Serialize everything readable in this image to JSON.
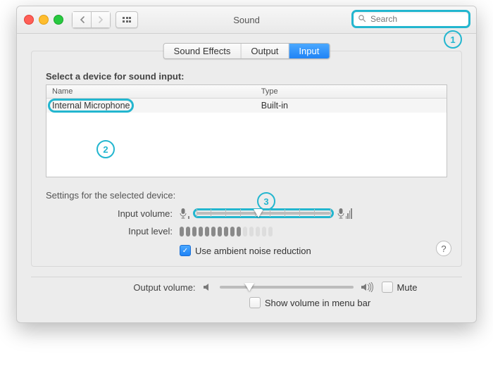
{
  "window": {
    "title": "Sound",
    "search_placeholder": "Search"
  },
  "tabs": [
    {
      "label": "Sound Effects",
      "active": false
    },
    {
      "label": "Output",
      "active": false
    },
    {
      "label": "Input",
      "active": true
    }
  ],
  "panel": {
    "select_device_label": "Select a device for sound input:",
    "columns": [
      "Name",
      "Type"
    ],
    "devices": [
      {
        "name": "Internal Microphone",
        "type": "Built-in"
      }
    ],
    "settings_label": "Settings for the selected device:",
    "input_volume_label": "Input volume:",
    "input_volume_value": 0.47,
    "input_level_label": "Input level:",
    "input_level_segments_total": 15,
    "input_level_segments_on": 10,
    "ambient_label": "Use ambient noise reduction",
    "ambient_checked": true
  },
  "footer": {
    "output_volume_label": "Output volume:",
    "output_volume_value": 0.22,
    "mute_label": "Mute",
    "mute_checked": false,
    "menubar_label": "Show volume in menu bar",
    "menubar_checked": false
  },
  "annotations": [
    "1",
    "2",
    "3"
  ],
  "colors": {
    "highlight": "#23b6cf",
    "accent": "#1f83f6"
  }
}
